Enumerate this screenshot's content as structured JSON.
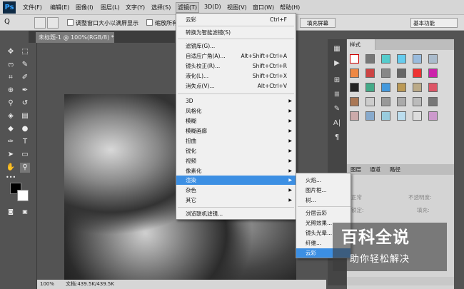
{
  "menubar": {
    "logo": "Ps",
    "items": [
      "文件(F)",
      "编辑(E)",
      "图像(I)",
      "图层(L)",
      "文字(Y)",
      "选择(S)",
      "滤镜(T)",
      "3D(D)",
      "视图(V)",
      "窗口(W)",
      "帮助(H)"
    ]
  },
  "options": {
    "zoom_icon": "Q",
    "resize_label": "调整窗口大小以满屏显示",
    "zoom_all_label": "缩放所有",
    "fill_screen_label": "填充屏幕",
    "workspace": "基本功能"
  },
  "document": {
    "tab_label": "未标题-1 @ 100%(RGB/8) *",
    "zoom": "100%",
    "doc_info": "文档:439.5K/439.5K"
  },
  "filter_menu": {
    "items": [
      {
        "label": "云彩",
        "shortcut": "Ctrl+F"
      },
      {
        "label": "转换为智能滤镜(S)",
        "shortcut": ""
      },
      {
        "label": "滤镜库(G)...",
        "shortcut": ""
      },
      {
        "label": "自适应广角(A)...",
        "shortcut": "Alt+Shift+Ctrl+A"
      },
      {
        "label": "镜头校正(R)...",
        "shortcut": "Shift+Ctrl+R"
      },
      {
        "label": "液化(L)...",
        "shortcut": "Shift+Ctrl+X"
      },
      {
        "label": "消失点(V)...",
        "shortcut": "Alt+Ctrl+V"
      },
      {
        "label": "3D",
        "shortcut": ""
      },
      {
        "label": "风格化",
        "shortcut": ""
      },
      {
        "label": "模糊",
        "shortcut": ""
      },
      {
        "label": "模糊画廊",
        "shortcut": ""
      },
      {
        "label": "扭曲",
        "shortcut": ""
      },
      {
        "label": "锐化",
        "shortcut": ""
      },
      {
        "label": "视频",
        "shortcut": ""
      },
      {
        "label": "像素化",
        "shortcut": ""
      },
      {
        "label": "渲染",
        "shortcut": ""
      },
      {
        "label": "杂色",
        "shortcut": ""
      },
      {
        "label": "其它",
        "shortcut": ""
      },
      {
        "label": "浏览联机滤镜...",
        "shortcut": ""
      }
    ]
  },
  "render_submenu": {
    "items": [
      "火焰...",
      "图片框...",
      "树...",
      "分层云彩",
      "光照效果...",
      "镜头光晕...",
      "纤维...",
      "云彩"
    ]
  },
  "panels": {
    "styles_tab": "样式",
    "layers_tab": "图层",
    "channels_tab": "通道",
    "paths_tab": "路径",
    "blend_mode": "正常",
    "opacity_label": "不透明度:",
    "lock_label": "锁定:",
    "fill_label": "填充:"
  },
  "watermark": {
    "main": "百科全说",
    "sub": "助你轻松解决"
  },
  "colors": {
    "highlight": "#3c8fe3",
    "menu_bg": "#f0f0f0"
  }
}
